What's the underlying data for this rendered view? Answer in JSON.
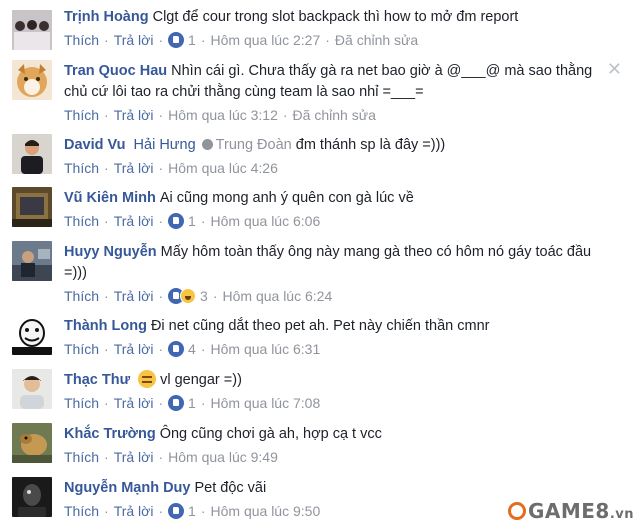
{
  "meta_labels": {
    "like": "Thích",
    "reply": "Trả lời",
    "dot": "·"
  },
  "comments": [
    {
      "author": "Trịnh Hoàng",
      "text": "Clgt để cour trong slot backpack thì how to mở đm report",
      "likes": "1",
      "time": "Hôm qua lúc 2:27",
      "edited": "Đã chỉnh sửa"
    },
    {
      "author": "Tran Quoc Hau",
      "text": "Nhìn cái gì. Chưa thấy gà ra net bao giờ à @___@ mà sao thằng chủ cứ lôi tao ra chửi thằng cùng team là sao nhỉ =___=",
      "likes": "",
      "time": "Hôm qua lúc 3:12",
      "edited": "Đã chỉnh sửa"
    },
    {
      "author": "David Vu",
      "tag1": "Hải Hưng",
      "tag2": "Trung Đoàn",
      "text": "đm thánh sp là đây =)))",
      "likes": "",
      "time": "Hôm qua lúc 4:26",
      "edited": ""
    },
    {
      "author": "Vũ Kiên Minh",
      "text": "Ai cũng mong anh ý quên con gà lúc về",
      "likes": "1",
      "time": "Hôm qua lúc 6:06",
      "edited": ""
    },
    {
      "author": "Huyy Nguyễn",
      "text": "Mấy hôm toàn thấy ông này mang gà theo có hôm nó gáy toác đầu =)))",
      "likes": "3",
      "time": "Hôm qua lúc 6:24",
      "edited": ""
    },
    {
      "author": "Thành Long",
      "text": "Đi net cũng dắt theo pet ah. Pet này chiến thần cmnr",
      "likes": "4",
      "time": "Hôm qua lúc 6:31",
      "edited": ""
    },
    {
      "author": "Thạc Thư",
      "text": "vl gengar =))",
      "likes": "1",
      "time": "Hôm qua lúc 7:08",
      "edited": ""
    },
    {
      "author": "Khắc Trường",
      "text": "Ông cũng chơi gà ah, hợp cạ t vcc",
      "likes": "",
      "time": "Hôm qua lúc 9:49",
      "edited": ""
    },
    {
      "author": "Nguyễn Mạnh Duy",
      "text": "Pet độc vãi",
      "likes": "1",
      "time": "Hôm qua lúc 9:50",
      "edited": ""
    }
  ],
  "watermark": {
    "brand": "GAME8",
    "tld": ".vn"
  },
  "colors": {
    "link": "#365899",
    "meta": "#90949c",
    "like_blue": "#4267b2"
  },
  "icons": [
    "like-icon",
    "haha-icon",
    "expressionless-emoji-icon",
    "close-icon",
    "verified-dot-icon"
  ]
}
